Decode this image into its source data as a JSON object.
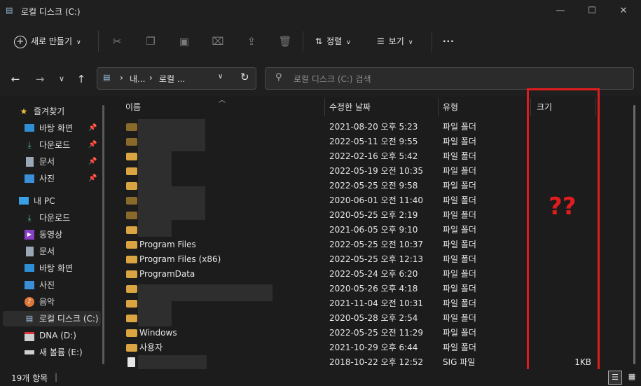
{
  "window": {
    "title": "로컬 디스크 (C:)"
  },
  "toolbar": {
    "new_label": "새로 만들기",
    "sort_label": "정렬",
    "view_label": "보기",
    "more_label": "···"
  },
  "address": {
    "crumb1": "내...",
    "crumb2": "로컬 ...",
    "search_placeholder": "로컬 디스크 (C:) 검색"
  },
  "sidebar": {
    "quick_access": "즐겨찾기",
    "quick_items": [
      "바탕 화면",
      "다운로드",
      "문서",
      "사진"
    ],
    "pc": "내 PC",
    "pc_items": [
      "다운로드",
      "동영상",
      "문서",
      "바탕 화면",
      "사진",
      "음악",
      "로컬 디스크 (C:)",
      "DNA (D:)",
      "새 볼륨 (E:)"
    ]
  },
  "columns": {
    "name": "이름",
    "date": "수정한 날짜",
    "type": "유형",
    "size": "크기"
  },
  "rows": [
    {
      "name": "",
      "date": "2021-08-20 오후 5:23",
      "type": "파일 폴더",
      "size": ""
    },
    {
      "name": "",
      "date": "2022-05-11 오전 9:55",
      "type": "파일 폴더",
      "size": ""
    },
    {
      "name": "",
      "date": "2022-02-16 오후 5:42",
      "type": "파일 폴더",
      "size": ""
    },
    {
      "name": "",
      "date": "2022-05-19 오전 10:35",
      "type": "파일 폴더",
      "size": ""
    },
    {
      "name": "",
      "date": "2022-05-25 오전 9:58",
      "type": "파일 폴더",
      "size": ""
    },
    {
      "name": "",
      "date": "2020-06-01 오전 11:40",
      "type": "파일 폴더",
      "size": ""
    },
    {
      "name": "",
      "date": "2020-05-25 오후 2:19",
      "type": "파일 폴더",
      "size": ""
    },
    {
      "name": "",
      "date": "2021-06-05 오후 9:10",
      "type": "파일 폴더",
      "size": ""
    },
    {
      "name": "Program Files",
      "date": "2022-05-25 오전 10:37",
      "type": "파일 폴더",
      "size": ""
    },
    {
      "name": "Program Files (x86)",
      "date": "2022-05-25 오후 12:13",
      "type": "파일 폴더",
      "size": ""
    },
    {
      "name": "ProgramData",
      "date": "2022-05-24 오후 6:20",
      "type": "파일 폴더",
      "size": ""
    },
    {
      "name": "",
      "date": "2020-05-26 오후 4:18",
      "type": "파일 폴더",
      "size": ""
    },
    {
      "name": "",
      "date": "2021-11-04 오전 10:31",
      "type": "파일 폴더",
      "size": ""
    },
    {
      "name": "",
      "date": "2020-05-28 오후 2:54",
      "type": "파일 폴더",
      "size": ""
    },
    {
      "name": "Windows",
      "date": "2022-05-25 오전 11:29",
      "type": "파일 폴더",
      "size": ""
    },
    {
      "name": "사용자",
      "date": "2021-10-29 오후 6:44",
      "type": "파일 폴더",
      "size": ""
    },
    {
      "name": "",
      "date": "2018-10-22 오후 12:52",
      "type": "SIG 파일",
      "size": "1KB"
    }
  ],
  "annotation": {
    "text": "??"
  },
  "status": {
    "count": "19개 항목"
  },
  "colors": {
    "accent_red": "#e11c1c",
    "folder": "#d9a441"
  }
}
